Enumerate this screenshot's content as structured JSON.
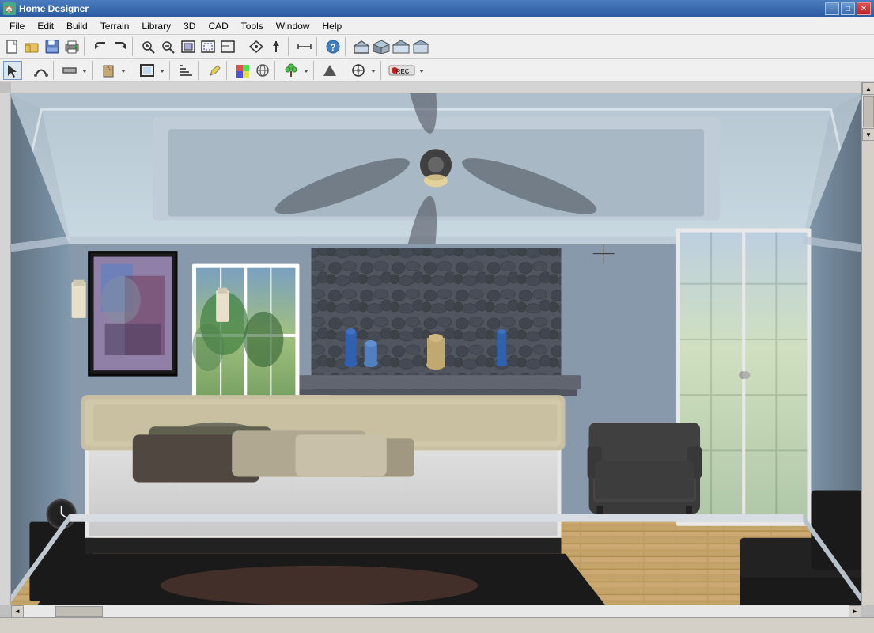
{
  "app": {
    "title": "Home Designer",
    "icon": "🏠"
  },
  "titlebar": {
    "title": "Home Designer",
    "min_btn": "–",
    "max_btn": "□",
    "close_btn": "✕"
  },
  "menubar": {
    "items": [
      {
        "label": "File",
        "id": "file"
      },
      {
        "label": "Edit",
        "id": "edit"
      },
      {
        "label": "Build",
        "id": "build"
      },
      {
        "label": "Terrain",
        "id": "terrain"
      },
      {
        "label": "Library",
        "id": "library"
      },
      {
        "label": "3D",
        "id": "3d"
      },
      {
        "label": "CAD",
        "id": "cad"
      },
      {
        "label": "Tools",
        "id": "tools"
      },
      {
        "label": "Window",
        "id": "window"
      },
      {
        "label": "Help",
        "id": "help"
      }
    ]
  },
  "toolbar1": {
    "buttons": [
      {
        "id": "new",
        "icon": "📄",
        "title": "New"
      },
      {
        "id": "open",
        "icon": "📂",
        "title": "Open"
      },
      {
        "id": "save",
        "icon": "💾",
        "title": "Save"
      },
      {
        "id": "print",
        "icon": "🖨",
        "title": "Print"
      },
      {
        "id": "sep1"
      },
      {
        "id": "undo",
        "icon": "↩",
        "title": "Undo"
      },
      {
        "id": "redo",
        "icon": "↪",
        "title": "Redo"
      },
      {
        "id": "sep2"
      },
      {
        "id": "zoom-in",
        "icon": "🔍+",
        "title": "Zoom In"
      },
      {
        "id": "zoom-out",
        "icon": "🔍-",
        "title": "Zoom Out"
      },
      {
        "id": "zoom-fit",
        "icon": "⊡",
        "title": "Zoom to Fit"
      },
      {
        "id": "zoom-box",
        "icon": "⊞",
        "title": "Zoom Box"
      },
      {
        "id": "zoom-prev",
        "icon": "⊟",
        "title": "Previous Zoom"
      },
      {
        "id": "sep3"
      },
      {
        "id": "pan",
        "icon": "✋",
        "title": "Pan"
      },
      {
        "id": "sep4"
      },
      {
        "id": "snap",
        "icon": "⊕",
        "title": "Snap"
      },
      {
        "id": "sep5"
      },
      {
        "id": "help",
        "icon": "?",
        "title": "Help"
      },
      {
        "id": "sep6"
      },
      {
        "id": "house1",
        "icon": "⌂",
        "title": "Floor Plan"
      },
      {
        "id": "house2",
        "icon": "🏠",
        "title": "3D View"
      },
      {
        "id": "house3",
        "icon": "⊞",
        "title": "Camera"
      },
      {
        "id": "house4",
        "icon": "⊟",
        "title": "Dollhouse"
      }
    ]
  },
  "toolbar2": {
    "buttons": [
      {
        "id": "select",
        "icon": "↖",
        "title": "Select Objects"
      },
      {
        "id": "sep1"
      },
      {
        "id": "arc",
        "icon": "⌒",
        "title": "Draw Arc"
      },
      {
        "id": "sep2"
      },
      {
        "id": "wall",
        "icon": "⊓",
        "title": "Draw Wall"
      },
      {
        "id": "sep3"
      },
      {
        "id": "door",
        "icon": "⊏",
        "title": "Door"
      },
      {
        "id": "sep4"
      },
      {
        "id": "floor",
        "icon": "▦",
        "title": "Floor"
      },
      {
        "id": "sep5"
      },
      {
        "id": "stair",
        "icon": "▤",
        "title": "Stair"
      },
      {
        "id": "sep6"
      },
      {
        "id": "roof",
        "icon": "⌂",
        "title": "Roof"
      },
      {
        "id": "sep7"
      },
      {
        "id": "pencil",
        "icon": "✏",
        "title": "Pencil"
      },
      {
        "id": "paint",
        "icon": "🎨",
        "title": "Paint"
      },
      {
        "id": "texture",
        "icon": "◈",
        "title": "Texture"
      },
      {
        "id": "sep8"
      },
      {
        "id": "plant",
        "icon": "🌿",
        "title": "Plant"
      },
      {
        "id": "sep9"
      },
      {
        "id": "arrow-up",
        "icon": "↑",
        "title": "Up"
      },
      {
        "id": "sep10"
      },
      {
        "id": "transform",
        "icon": "⊕",
        "title": "Transform"
      },
      {
        "id": "sep11"
      },
      {
        "id": "rec",
        "icon": "REC",
        "title": "Record"
      }
    ]
  },
  "statusbar": {
    "text": ""
  },
  "colors": {
    "wall_blue": "#8899aa",
    "ceiling": "#9aabb8",
    "floor_wood": "#c8a870",
    "window_frame": "#ffffff",
    "fireplace_stone": "#555560",
    "bed_frame": "#2a2a2a"
  }
}
